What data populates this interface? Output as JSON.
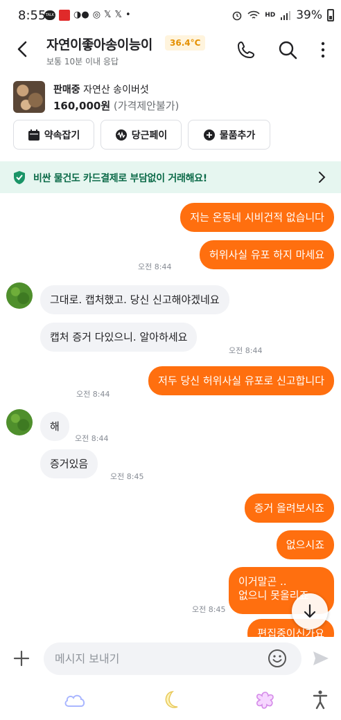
{
  "status_bar": {
    "time": "8:55",
    "battery": "39%",
    "signal_label": "HD"
  },
  "header": {
    "title": "자연이좋아송이능이",
    "temperature": "36.4°C",
    "subtitle": "보통 10분 이내 응답"
  },
  "product": {
    "status": "판매중",
    "name": "자연산 송이버섯",
    "price": "160,000원",
    "price_note": "(가격제안불가)"
  },
  "actions": [
    {
      "label": "약속잡기",
      "icon": "calendar-icon"
    },
    {
      "label": "당근페이",
      "icon": "pay-icon"
    },
    {
      "label": "물품추가",
      "icon": "plus-circle-icon"
    }
  ],
  "banner": {
    "text": "비싼 물건도 카드결제로 부담없이 거래해요!"
  },
  "messages": [
    {
      "side": "out",
      "text": "저는 온동네 시비건적 없습니다"
    },
    {
      "side": "out",
      "text": "허위사실 유포 하지 마세요",
      "time": "오전 8:44"
    },
    {
      "side": "in",
      "text": "그대로. 캡처했고. 당신  신고해야겠네요"
    },
    {
      "side": "in",
      "text": "캡처 증거 다있으니. 알아하세요",
      "time": "오전 8:44"
    },
    {
      "side": "out",
      "text": "저두 당신 허위사실 유포로 신고합니다",
      "time": "오전 8:44"
    },
    {
      "side": "in",
      "text": "해",
      "time": "오전 8:44"
    },
    {
      "side": "in",
      "text": "증거있음",
      "time": "오전 8:45"
    },
    {
      "side": "out",
      "text": "증거 올려보시죠"
    },
    {
      "side": "out",
      "text": "없으시죠"
    },
    {
      "side": "out",
      "line1": "이거말곤 ..",
      "line2": "없으니 못올리죠",
      "time": "오전 8:45"
    },
    {
      "side": "out",
      "text": "편집중이신가요"
    }
  ],
  "input": {
    "placeholder": "메시지 보내기"
  },
  "colors": {
    "accent": "#ff6f0f",
    "incoming_bubble": "#f2f3f6",
    "banner_bg": "#e6f6f0",
    "banner_text": "#0b6a48",
    "temperature": "#e48f00"
  }
}
